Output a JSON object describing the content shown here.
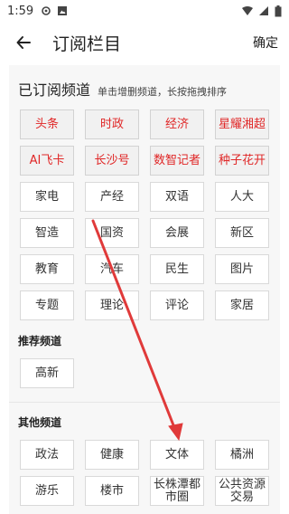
{
  "status": {
    "time": "1:59"
  },
  "header": {
    "title": "订阅栏目",
    "confirm_label": "确定"
  },
  "subscribed": {
    "title": "已订阅频道",
    "hint": "单击增删频道，长按拖拽排序",
    "red_items": [
      "头条",
      "时政",
      "经济",
      "星耀湘超",
      "AI飞卡",
      "长沙号",
      "数智记者",
      "种子花开"
    ],
    "items": [
      "家电",
      "产经",
      "双语",
      "人大",
      "智造",
      "国资",
      "会展",
      "新区",
      "教育",
      "汽车",
      "民生",
      "图片",
      "专题",
      "理论",
      "评论",
      "家居"
    ]
  },
  "recommended": {
    "title": "推荐频道",
    "items": [
      "高新"
    ]
  },
  "other": {
    "title": "其他频道",
    "items": [
      "政法",
      "健康",
      "文体",
      "橘洲",
      "游乐",
      "楼市",
      "长株潭都市圈",
      "公共资源交易"
    ]
  },
  "colors": {
    "accent_red": "#e02727",
    "arrow_red": "#e03a3a"
  }
}
